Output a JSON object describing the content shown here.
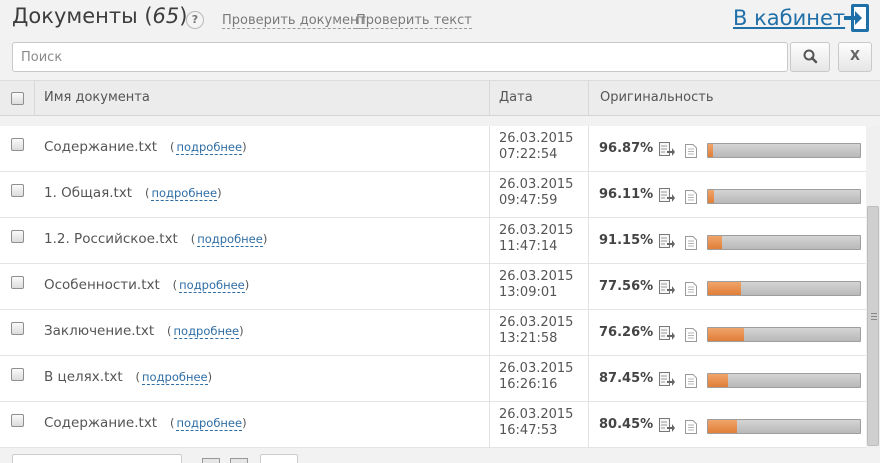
{
  "header": {
    "title": "Документы",
    "count": "65",
    "help_label": "?",
    "links": [
      "Проверить документ",
      "Проверить текст"
    ],
    "cabinet_label": "В кабинет"
  },
  "search": {
    "placeholder": "Поиск",
    "value": "",
    "clear_label": "X"
  },
  "table": {
    "columns": [
      "Имя документа",
      "Дата",
      "Оригинальность"
    ],
    "more_label": "подробнее",
    "rows": [
      {
        "name": "Содержание.txt",
        "date": "26.03.2015",
        "time": "07:22:54",
        "originality": "96.87%",
        "fill": 0.03
      },
      {
        "name": "1. Общая.txt",
        "date": "26.03.2015",
        "time": "09:47:59",
        "originality": "96.11%",
        "fill": 0.04
      },
      {
        "name": "1.2. Российское.txt",
        "date": "26.03.2015",
        "time": "11:47:14",
        "originality": "91.15%",
        "fill": 0.09
      },
      {
        "name": "Особенности.txt",
        "date": "26.03.2015",
        "time": "13:09:01",
        "originality": "77.56%",
        "fill": 0.22
      },
      {
        "name": "Заключение.txt",
        "date": "26.03.2015",
        "time": "13:21:58",
        "originality": "76.26%",
        "fill": 0.24
      },
      {
        "name": "В целях.txt",
        "date": "26.03.2015",
        "time": "16:26:16",
        "originality": "87.45%",
        "fill": 0.13
      },
      {
        "name": "Содержание.txt",
        "date": "26.03.2015",
        "time": "16:47:53",
        "originality": "80.45%",
        "fill": 0.19
      }
    ]
  },
  "colors": {
    "accent_link": "#2e6da4",
    "bar_fill": "#e07e38",
    "bar_track": "#c6c6c6"
  },
  "icons": [
    "help-icon",
    "exit-icon",
    "search-icon",
    "check-report-icon",
    "document-icon"
  ]
}
